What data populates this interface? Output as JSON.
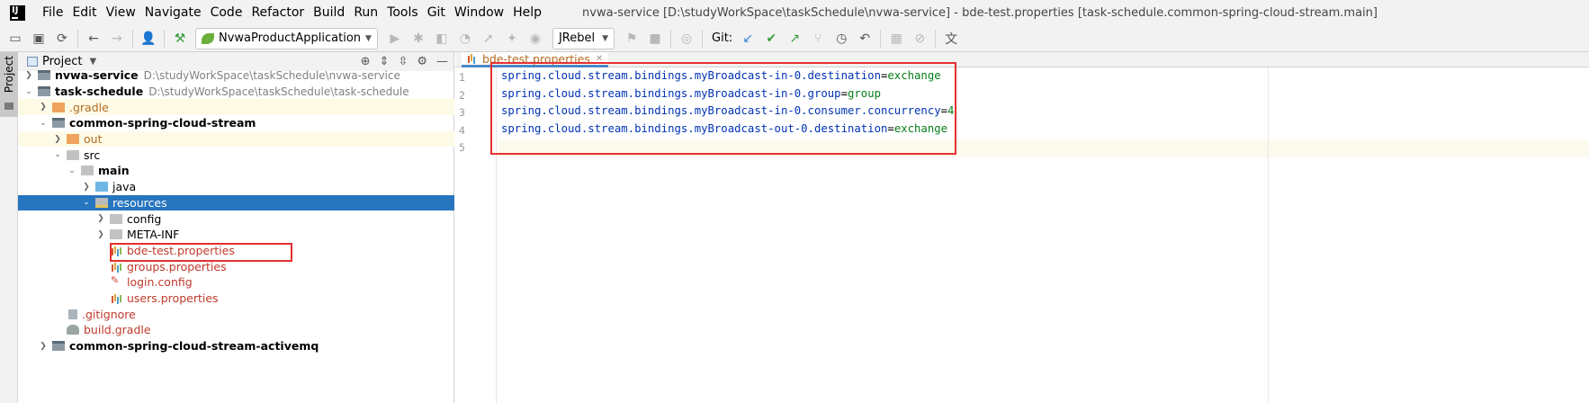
{
  "window": {
    "title": "nvwa-service [D:\\studyWorkSpace\\taskSchedule\\nvwa-service] - bde-test.properties [task-schedule.common-spring-cloud-stream.main]"
  },
  "menu": [
    "File",
    "Edit",
    "View",
    "Navigate",
    "Code",
    "Refactor",
    "Build",
    "Run",
    "Tools",
    "Git",
    "Window",
    "Help"
  ],
  "toolbar": {
    "run_config": "NvwaProductApplication",
    "jrebel": "JRebel",
    "git_label": "Git:"
  },
  "tool_stripe": {
    "project_tab": "Project"
  },
  "project_panel": {
    "title": "Project",
    "tree": [
      {
        "name": "nvwa-service",
        "path": "D:\\studyWorkSpace\\taskSchedule\\nvwa-service"
      },
      {
        "name": "task-schedule",
        "path": "D:\\studyWorkSpace\\taskSchedule\\task-schedule"
      },
      {
        "name": ".gradle"
      },
      {
        "name": "common-spring-cloud-stream"
      },
      {
        "name": "out"
      },
      {
        "name": "src"
      },
      {
        "name": "main"
      },
      {
        "name": "java"
      },
      {
        "name": "resources"
      },
      {
        "name": "config"
      },
      {
        "name": "META-INF"
      },
      {
        "name": "bde-test.properties"
      },
      {
        "name": "groups.properties"
      },
      {
        "name": "login.config"
      },
      {
        "name": "users.properties"
      },
      {
        "name": ".gitignore"
      },
      {
        "name": "build.gradle"
      },
      {
        "name": "common-spring-cloud-stream-activemq"
      }
    ]
  },
  "editor": {
    "tab": "bde-test.properties",
    "lines": [
      {
        "num": "1",
        "key": "spring.cloud.stream.bindings.myBroadcast-in-0.destination",
        "eq": "=",
        "value": "exchange"
      },
      {
        "num": "2",
        "key": "spring.cloud.stream.bindings.myBroadcast-in-0.group",
        "eq": "=",
        "value": "group"
      },
      {
        "num": "3",
        "key": "spring.cloud.stream.bindings.myBroadcast-in-0.consumer.concurrency",
        "eq": "=",
        "value": "4"
      },
      {
        "num": "4",
        "key": "spring.cloud.stream.bindings.myBroadcast-out-0.destination",
        "eq": "=",
        "value": "exchange"
      },
      {
        "num": "5",
        "key": "",
        "eq": "",
        "value": ""
      }
    ]
  },
  "colors": {
    "selection": "#2675bf",
    "annotation_box": "#e53030",
    "property_key": "#0033b3",
    "property_value": "#067d17"
  }
}
